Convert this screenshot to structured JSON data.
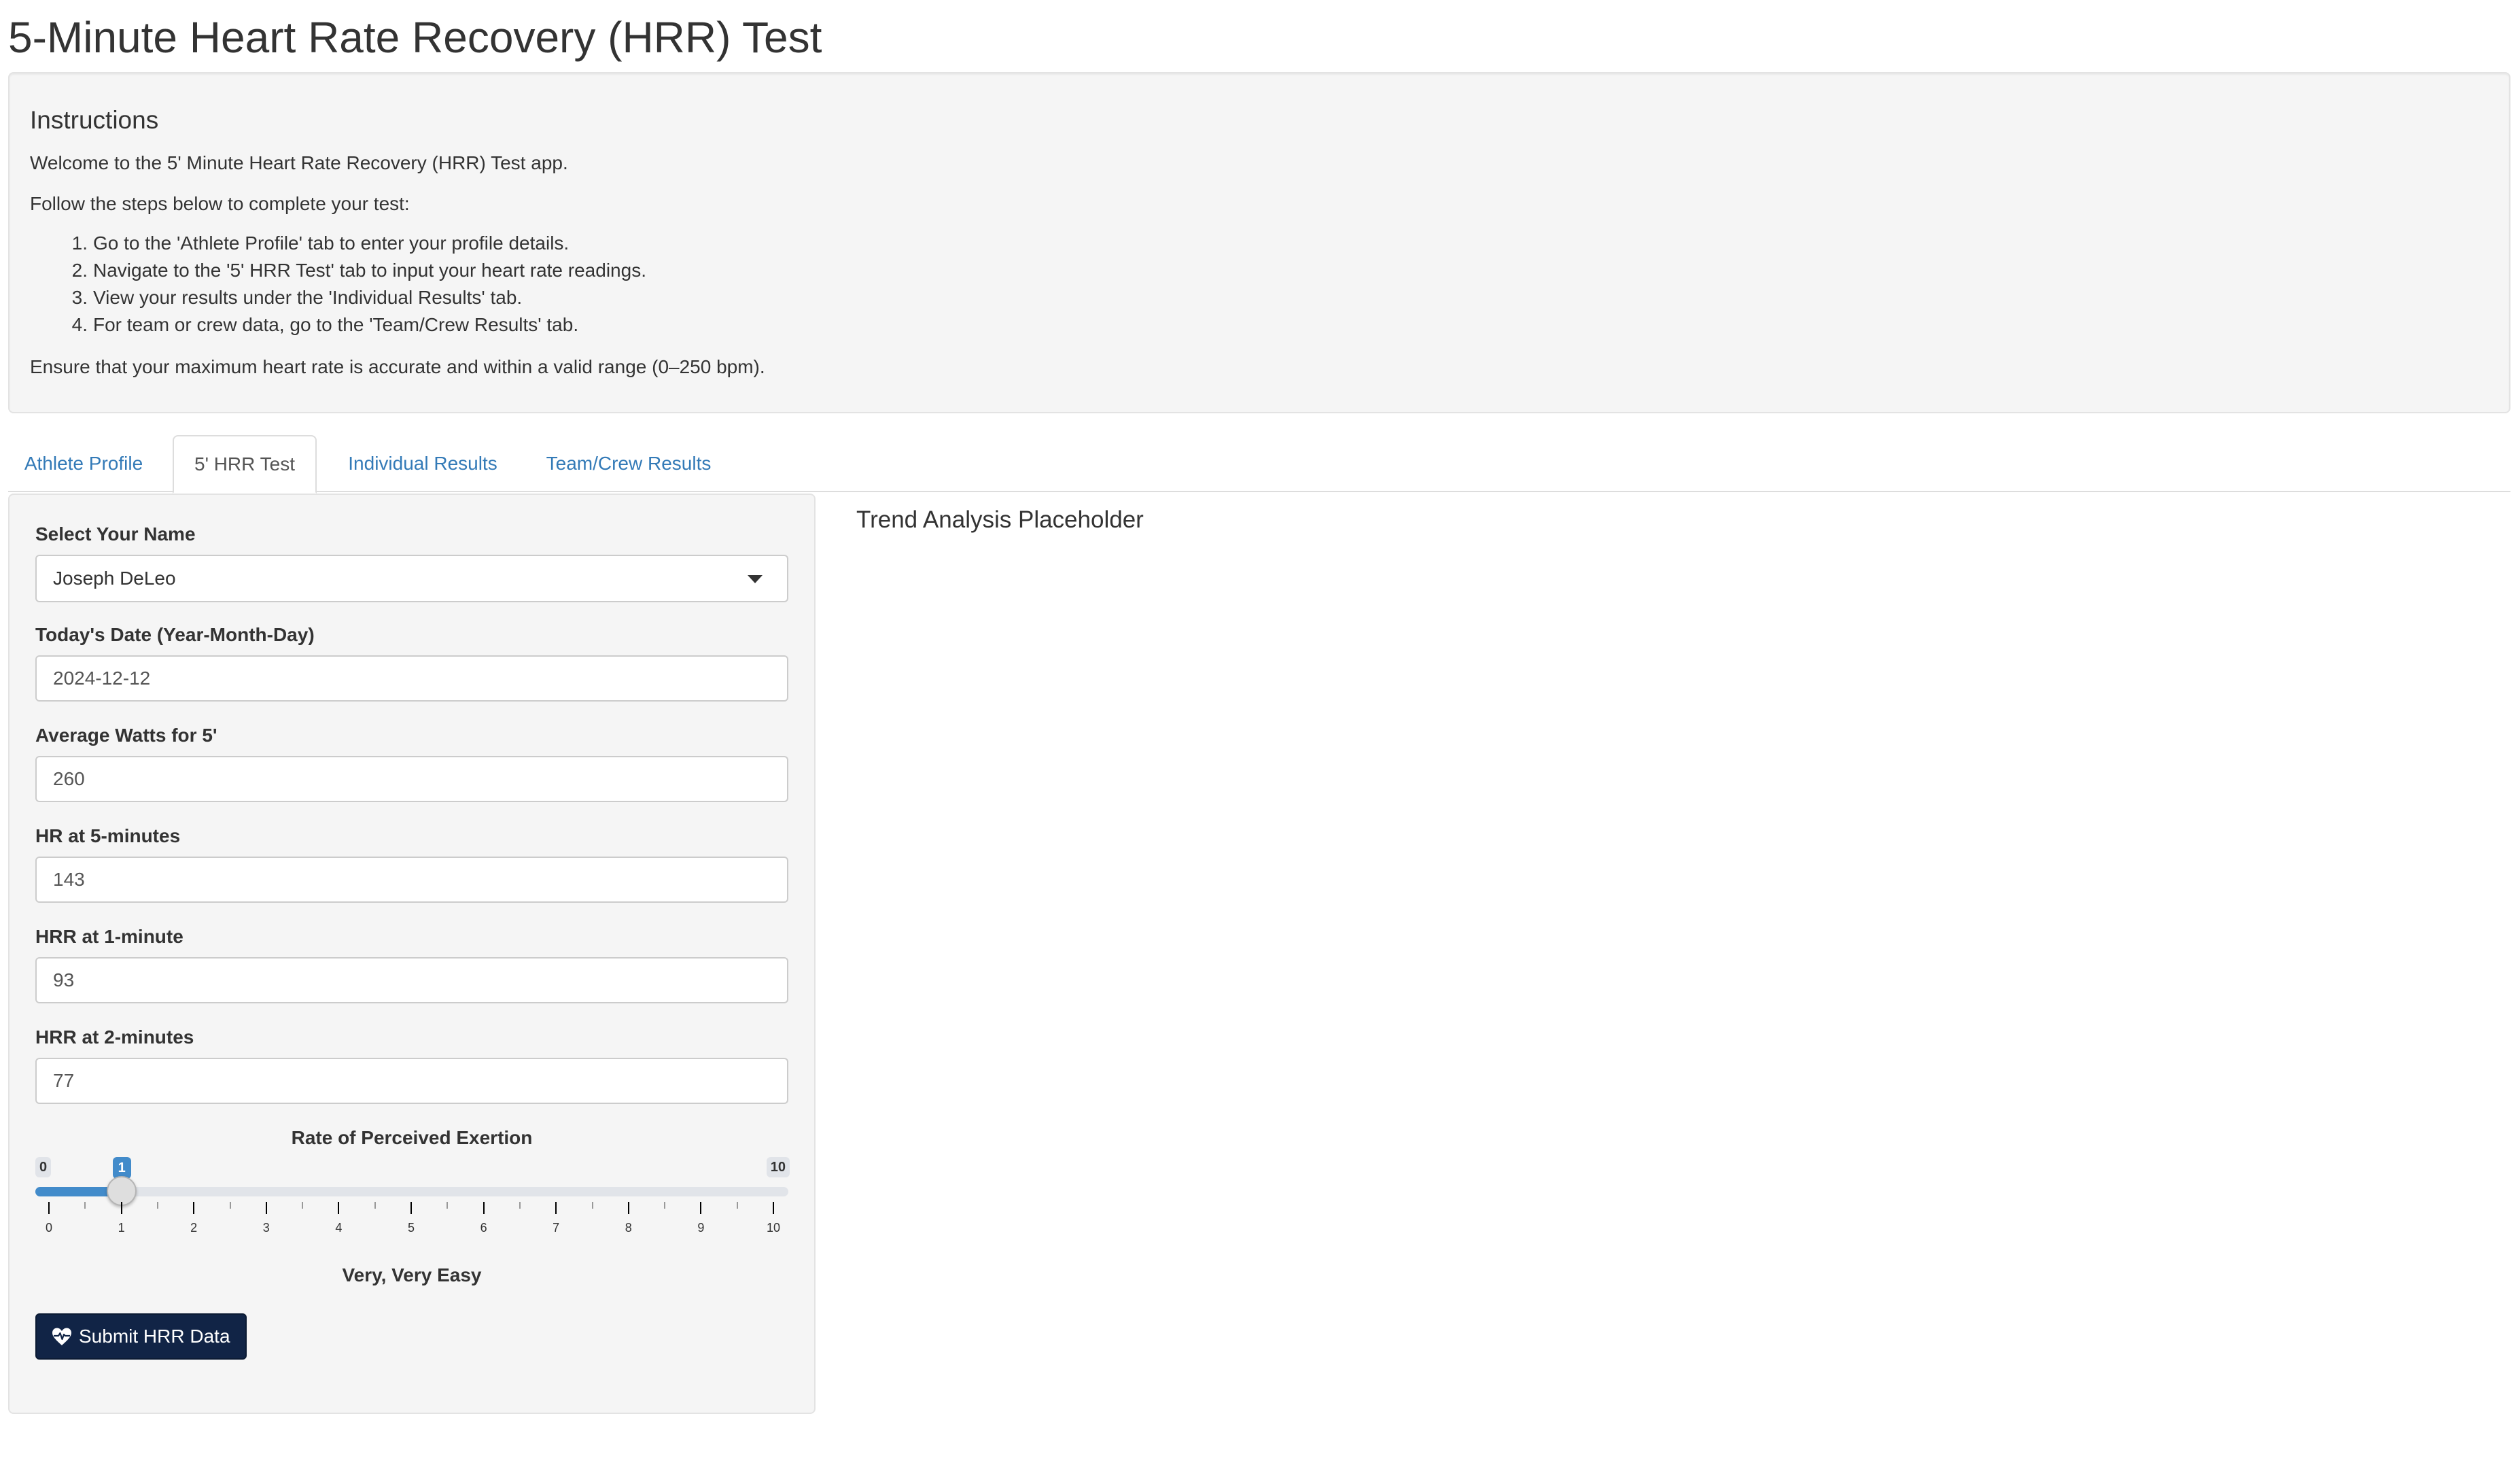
{
  "page": {
    "title": "5-Minute Heart Rate Recovery (HRR) Test"
  },
  "instructions": {
    "heading": "Instructions",
    "welcome": "Welcome to the 5' Minute Heart Rate Recovery (HRR) Test app.",
    "follow": "Follow the steps below to complete your test:",
    "steps": [
      {
        "num": "1.",
        "text": "Go to the 'Athlete Profile' tab to enter your profile details."
      },
      {
        "num": "2.",
        "text": "Navigate to the '5' HRR Test' tab to input your heart rate readings."
      },
      {
        "num": "3.",
        "text": "View your results under the 'Individual Results' tab."
      },
      {
        "num": "4.",
        "text": "For team or crew data, go to the 'Team/Crew Results' tab."
      }
    ],
    "note": "Ensure that your maximum heart rate is accurate and within a valid range (0–250 bpm)."
  },
  "tabs": [
    {
      "label": "Athlete Profile",
      "active": false
    },
    {
      "label": "5' HRR Test",
      "active": true
    },
    {
      "label": "Individual Results",
      "active": false
    },
    {
      "label": "Team/Crew Results",
      "active": false
    }
  ],
  "form": {
    "name": {
      "label": "Select Your Name",
      "value": "Joseph DeLeo"
    },
    "date": {
      "label": "Today's Date (Year-Month-Day)",
      "value": "2024-12-12"
    },
    "watts": {
      "label": "Average Watts for 5'",
      "value": "260"
    },
    "hr5": {
      "label": "HR at 5-minutes",
      "value": "143"
    },
    "hrr1": {
      "label": "HRR at 1-minute",
      "value": "93"
    },
    "hrr2": {
      "label": "HRR at 2-minutes",
      "value": "77"
    },
    "rpe": {
      "label": "Rate of Perceived Exertion",
      "min": 0,
      "max": 10,
      "value": 1,
      "min_label": "0",
      "max_label": "10",
      "value_label": "1",
      "tick_labels": [
        "0",
        "1",
        "2",
        "3",
        "4",
        "5",
        "6",
        "7",
        "8",
        "9",
        "10"
      ],
      "description": "Very, Very Easy"
    },
    "submit_label": "Submit HRR Data",
    "submit_icon": "heartbeat-icon"
  },
  "main": {
    "title": "Trend Analysis Placeholder"
  },
  "colors": {
    "link": "#337ab7",
    "slider_accent": "#428bca",
    "submit_bg": "#112446"
  }
}
